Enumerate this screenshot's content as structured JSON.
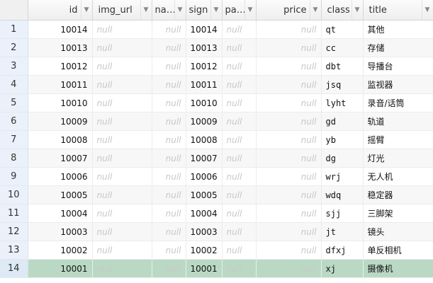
{
  "columns": {
    "id": "id",
    "img_url": "img_url",
    "name": "na…",
    "sign": "sign",
    "pa": "pa…",
    "price": "price",
    "class": "class",
    "title": "title"
  },
  "null_text": "null",
  "rows": [
    {
      "n": "1",
      "id": "10014",
      "sign": "10014",
      "class": "qt",
      "title": "其他"
    },
    {
      "n": "2",
      "id": "10013",
      "sign": "10013",
      "class": "cc",
      "title": "存储"
    },
    {
      "n": "3",
      "id": "10012",
      "sign": "10012",
      "class": "dbt",
      "title": "导播台"
    },
    {
      "n": "4",
      "id": "10011",
      "sign": "10011",
      "class": "jsq",
      "title": "监视器"
    },
    {
      "n": "5",
      "id": "10010",
      "sign": "10010",
      "class": "lyht",
      "title": "录音/话筒"
    },
    {
      "n": "6",
      "id": "10009",
      "sign": "10009",
      "class": "gd",
      "title": "轨道"
    },
    {
      "n": "7",
      "id": "10008",
      "sign": "10008",
      "class": "yb",
      "title": "摇臂"
    },
    {
      "n": "8",
      "id": "10007",
      "sign": "10007",
      "class": "dg",
      "title": "灯光"
    },
    {
      "n": "9",
      "id": "10006",
      "sign": "10006",
      "class": "wrj",
      "title": "无人机"
    },
    {
      "n": "10",
      "id": "10005",
      "sign": "10005",
      "class": "wdq",
      "title": "稳定器"
    },
    {
      "n": "11",
      "id": "10004",
      "sign": "10004",
      "class": "sjj",
      "title": "三脚架"
    },
    {
      "n": "12",
      "id": "10003",
      "sign": "10003",
      "class": "jt",
      "title": "镜头"
    },
    {
      "n": "13",
      "id": "10002",
      "sign": "10002",
      "class": "dfxj",
      "title": "单反相机"
    },
    {
      "n": "14",
      "id": "10001",
      "sign": "10001",
      "class": "xj",
      "title": "摄像机"
    }
  ],
  "selected_row": "14",
  "colors": {
    "selected_row": "#b9d9c5",
    "row_number_bg": "#eaf1fa",
    "null_text": "#c8c8c8"
  }
}
